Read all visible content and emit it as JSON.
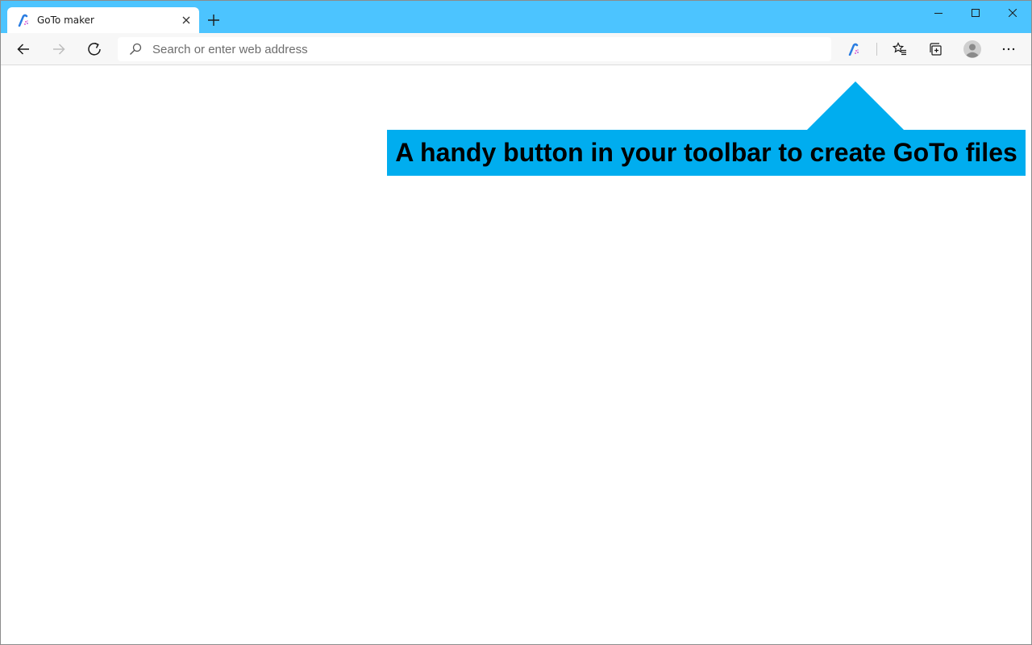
{
  "tab": {
    "title": "GoTo maker"
  },
  "addressbar": {
    "placeholder": "Search or enter web address",
    "value": ""
  },
  "callout": {
    "text": "A handy button in your toolbar to create GoTo files"
  },
  "colors": {
    "titlebar": "#4cc4ff",
    "callout": "#00adef",
    "toolbar": "#f7f7f7"
  },
  "icons": {
    "tab_favicon": "goto-maker-icon",
    "back": "arrow-left-icon",
    "forward": "arrow-right-icon",
    "refresh": "refresh-icon",
    "search": "search-icon",
    "extension": "goto-maker-icon",
    "favorites": "favorites-icon",
    "collections": "collections-icon",
    "profile": "profile-icon",
    "menu": "more-icon"
  }
}
